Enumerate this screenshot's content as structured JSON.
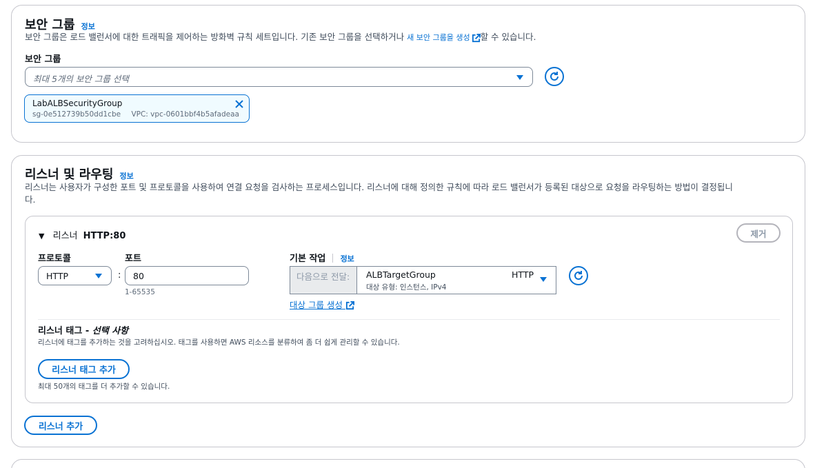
{
  "security": {
    "title": "보안 그룹",
    "info": "정보",
    "desc_before": "보안 그룹은 로드 밸런서에 대한 트래픽을 제어하는 방화벽 규칙 세트입니다. 기존 보안 그룹을 선택하거나 ",
    "desc_link": "새 보안 그룹을 생성",
    "desc_after": "할 수 있습니다.",
    "field_label": "보안 그룹",
    "select_placeholder": "최대 5개의 보안 그룹 선택",
    "token": {
      "name": "LabALBSecurityGroup",
      "id": "sg-0e512739b50dd1cbe",
      "vpc": "VPC: vpc-0601bbf4b5afadeaa"
    }
  },
  "listeners": {
    "title": "리스너 및 라우팅",
    "info": "정보",
    "desc": "리스너는 사용자가 구성한 포트 및 프로토콜을 사용하여 연결 요청을 검사하는 프로세스입니다. 리스너에 대해 정의한 규칙에 따라 로드 밸런서가 등록된 대상으로 요청을 라우팅하는 방법이 결정됩니",
    "desc_wrap": "다.",
    "listener": {
      "prefix": "리스너",
      "name": "HTTP:80",
      "remove_label": "제거",
      "protocol_label": "프로토콜",
      "protocol_value": "HTTP",
      "colon": ":",
      "port_label": "포트",
      "port_value": "80",
      "port_hint": "1-65535",
      "default_action_label": "기본 작업",
      "default_action_info": "정보",
      "forward_label": "다음으로 전달:",
      "target_name": "ALBTargetGroup",
      "target_protocol": "HTTP",
      "target_sub": "대상 유형: 인스턴스, IPv4",
      "create_target_link": "대상 그룹 생성",
      "tags_title": "리스너 태그 - ",
      "tags_optional": "선택 사항",
      "tags_desc": "리스너에 태그를 추가하는 것을 고려하십시오. 태그를 사용하면 AWS 리소스를 분류하여 좀 더 쉽게 관리할 수 있습니다.",
      "add_tag_button": "리스너 태그 추가",
      "tag_limit": "최대 50개의 태그를 더 추가할 수 있습니다."
    },
    "add_listener_button": "리스너 추가"
  },
  "colors": {
    "accent": "#0972d3",
    "text": "#0f141a",
    "border": "#c6c6cd",
    "token_bg": "#f0fbff"
  },
  "icons": [
    "caret-down-icon",
    "refresh-icon",
    "close-icon",
    "external-link-icon",
    "expand-triangle-icon"
  ]
}
